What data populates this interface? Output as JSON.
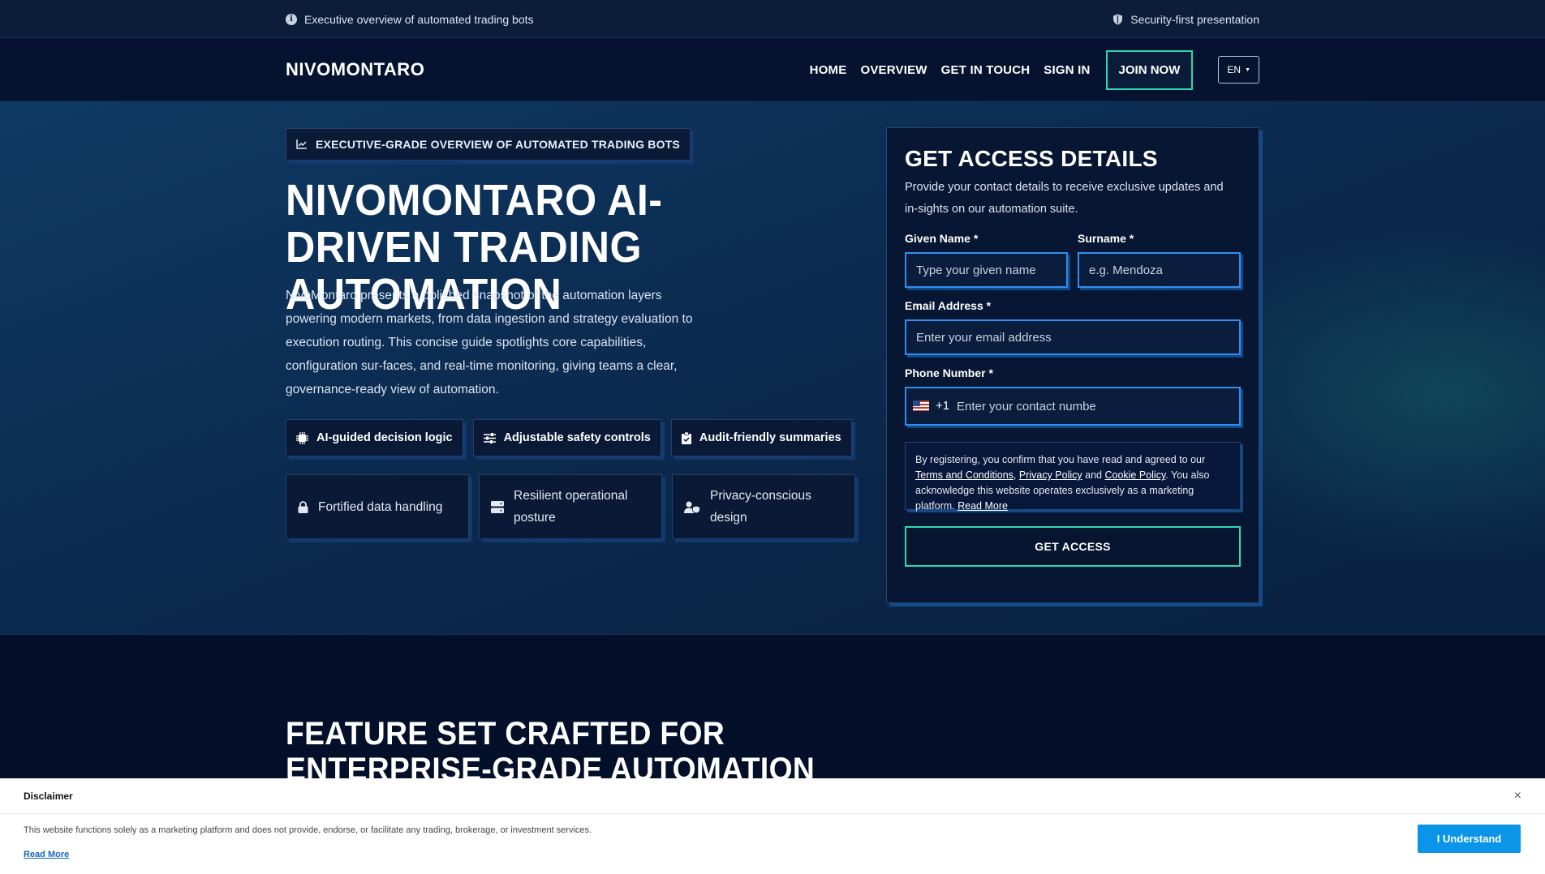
{
  "topbar": {
    "left_text": "Executive overview of automated trading bots",
    "left_icon": "info-icon",
    "right_text": "Security-first presentation",
    "right_icon": "shield-icon"
  },
  "header": {
    "logo": "NIVOMONTARO",
    "nav": [
      "HOME",
      "OVERVIEW",
      "GET IN TOUCH",
      "SIGN IN"
    ],
    "join_label": "JOIN NOW",
    "lang_label": "EN"
  },
  "hero": {
    "badge": "EXECUTIVE-GRADE OVERVIEW OF AUTOMATED TRADING BOTS",
    "title": "NIVOMONTARO AI-DRIVEN TRADING AUTOMATION",
    "description": "NivoMontaro presents a polished snapshot of the automation layers powering modern markets, from data ingestion and strategy evaluation to execution routing. This concise guide spotlights core capabilities, configuration sur-faces, and real-time monitoring, giving teams a clear, governance-ready view of automation.",
    "chips": [
      "AI-guided decision logic",
      "Adjustable safety controls",
      "Audit-friendly summaries"
    ],
    "cards": [
      "Fortified data handling",
      "Resilient operational posture",
      "Privacy-conscious design"
    ]
  },
  "form": {
    "title": "GET ACCESS DETAILS",
    "subtitle": "Provide your contact details to receive exclusive updates and in-sights on our automation suite.",
    "given_label": "Given Name *",
    "given_placeholder": "Type your given name",
    "surname_label": "Surname *",
    "surname_placeholder": "e.g. Mendoza",
    "email_label": "Email Address *",
    "email_placeholder": "Enter your email address",
    "phone_label": "Phone Number *",
    "phone_code": "+1",
    "phone_placeholder": "Enter your contact numbe",
    "consent_prefix": "By registering, you confirm that you have read and agreed to our ",
    "terms": "Terms and Conditions",
    "comma": ", ",
    "privacy": "Privacy Policy",
    "and": " and ",
    "cookie": "Cookie Policy",
    "consent_suffix": ". You also acknowledge this website operates exclusively as a marketing platform. ",
    "read_more": "Read More",
    "submit": "GET ACCESS"
  },
  "features": {
    "title": "FEATURE SET CRAFTED FOR ENTERPRISE-GRADE AUTOMATION"
  },
  "disclaimer": {
    "title": "Disclaimer",
    "close": "×",
    "text": "This website functions solely as a marketing platform and does not provide, endorse, or facilitate any trading, brokerage, or investment services.",
    "read_more": "Read More",
    "button": "I Understand"
  },
  "colors": {
    "accent": "#2fd6b0",
    "input_border": "#2e8ff0",
    "button_blue": "#0b95e8"
  }
}
